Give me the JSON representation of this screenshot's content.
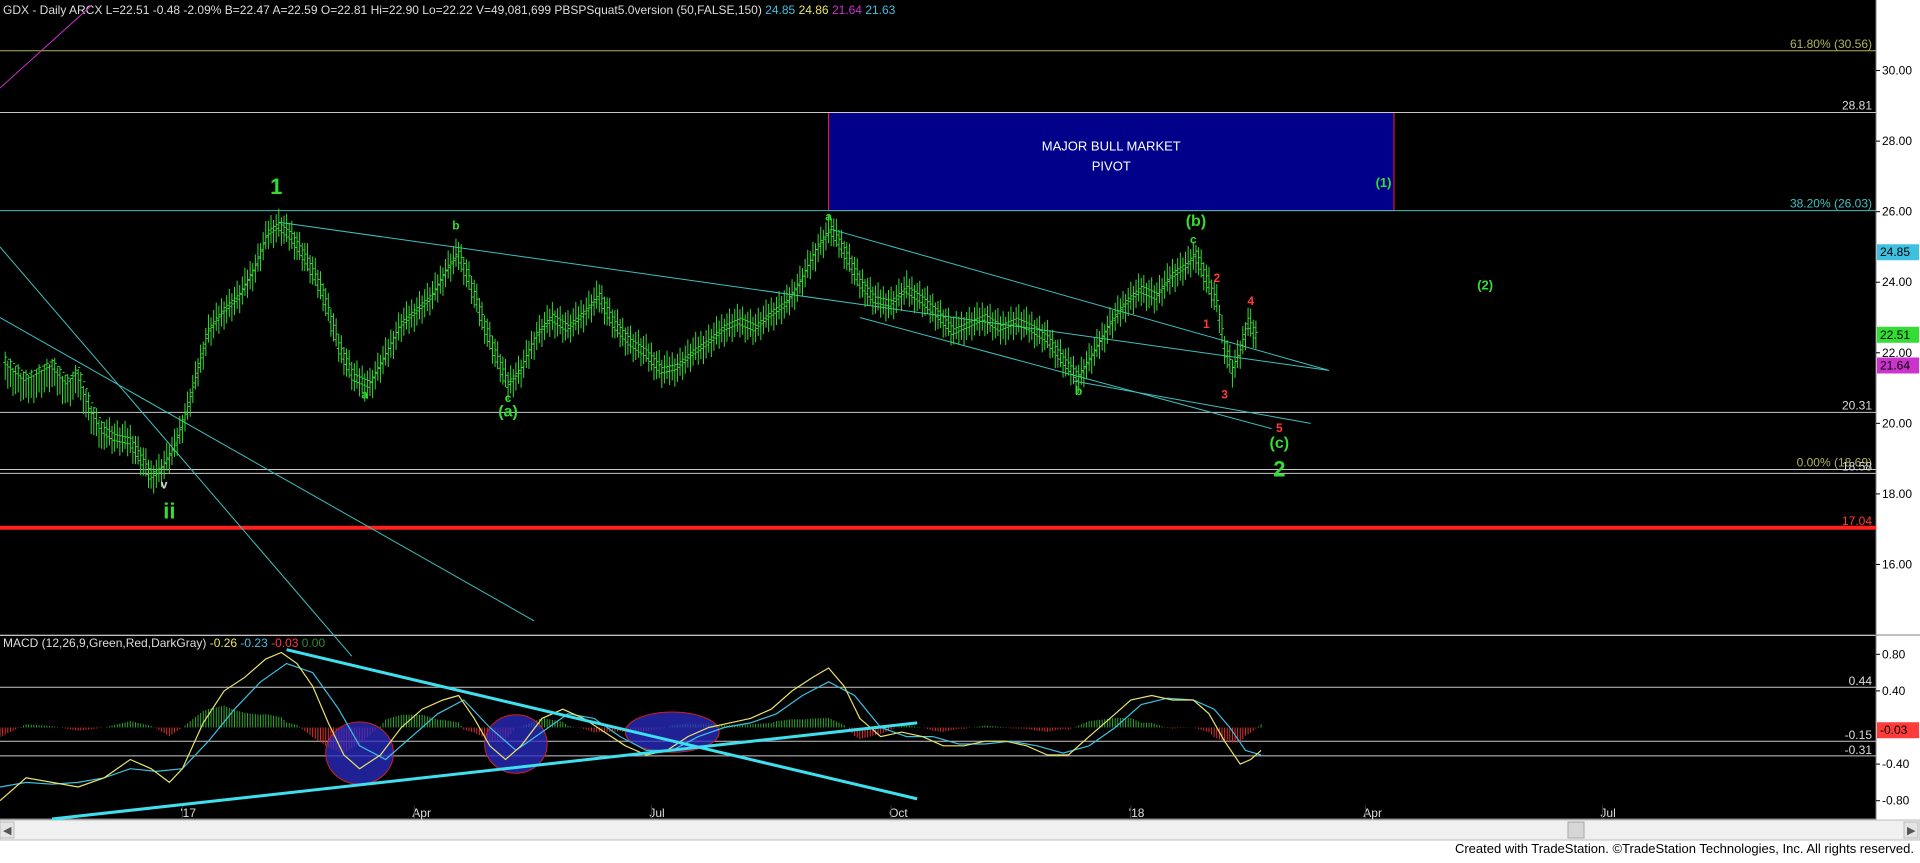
{
  "header": {
    "symbol_line": "GDX - Daily  ARCX  L=22.51  -0.48  -2.09%  B=22.47  A=22.59  O=22.81  Hi=22.90  Lo=22.22  V=49,081,699  PBSPSquat5.0version (50,FALSE,150)",
    "values": [
      {
        "text": "24.85",
        "color": "#3ec0e0"
      },
      {
        "text": "24.86",
        "color": "#e8e36a"
      },
      {
        "text": "21.64",
        "color": "#cc33cc"
      },
      {
        "text": "21.63",
        "color": "#3ec0e0"
      }
    ]
  },
  "macd": {
    "title": "MACD (12,26,9,Green,Red,DarkGray)",
    "values": [
      {
        "text": "-0.26",
        "color": "#e8e36a"
      },
      {
        "text": "-0.23",
        "color": "#3ec0e0"
      },
      {
        "text": "-0.03",
        "color": "#ff3b3b"
      },
      {
        "text": "0.00",
        "color": "#2e8b2e"
      }
    ],
    "ticks": [
      {
        "label": "0.80",
        "value": 0.8
      },
      {
        "label": "0.40",
        "value": 0.4
      },
      {
        "label": "-0.40",
        "value": -0.4
      },
      {
        "label": "-0.80",
        "value": -0.8
      }
    ],
    "level_labels": [
      {
        "label": "0.44",
        "value": 0.44
      },
      {
        "label": "-0.15",
        "value": -0.15
      },
      {
        "label": "-0.31",
        "value": -0.31
      }
    ],
    "current_badge": {
      "label": "-0.03",
      "value": -0.03,
      "color": "#ff3b3b"
    }
  },
  "pivot_box": {
    "line1": "MAJOR BULL MARKET",
    "line2": "PIVOT",
    "low": 26.03,
    "high": 28.81
  },
  "price_axis": {
    "ticks": [
      {
        "label": "30.00",
        "value": 30
      },
      {
        "label": "28.00",
        "value": 28
      },
      {
        "label": "26.00",
        "value": 26
      },
      {
        "label": "24.00",
        "value": 24
      },
      {
        "label": "22.00",
        "value": 22
      },
      {
        "label": "20.00",
        "value": 20
      },
      {
        "label": "18.00",
        "value": 18
      },
      {
        "label": "16.00",
        "value": 16
      }
    ],
    "badges": [
      {
        "label": "24.85",
        "value": 24.85,
        "color": "#3ec0e0"
      },
      {
        "label": "22.51",
        "value": 22.51,
        "color": "#33dd33"
      },
      {
        "label": "21.64",
        "value": 21.64,
        "color": "#cc33cc"
      }
    ]
  },
  "levels": [
    {
      "label": "61.80% (30.56)",
      "value": 30.56,
      "color": "#b3b35a",
      "label_color": "#b3b35a"
    },
    {
      "label": "28.81",
      "value": 28.81,
      "color": "#c8c8c8",
      "label_color": "#dddddd"
    },
    {
      "label": "38.20% (26.03)",
      "value": 26.03,
      "color": "#3ec0c0",
      "label_color": "#3ec0c0"
    },
    {
      "label": "20.31",
      "value": 20.31,
      "color": "#c8c8c8",
      "label_color": "#dddddd"
    },
    {
      "label": "0.00% (18.69)",
      "value": 18.69,
      "color": "#c8c8c8",
      "label_color": "#b3b35a"
    },
    {
      "label": "18.58",
      "value": 18.58,
      "color": "#c8c8c8",
      "label_color": "#dddddd"
    },
    {
      "label": "17.04",
      "value": 17.04,
      "color": "#ff2020",
      "label_color": "#ff3b3b"
    }
  ],
  "x_axis": {
    "ticks": [
      {
        "label": "'17",
        "day": 30
      },
      {
        "label": "Apr",
        "day": 119
      },
      {
        "label": "Jul",
        "day": 210
      },
      {
        "label": "Oct",
        "day": 302
      },
      {
        "label": "'18",
        "day": 394
      },
      {
        "label": "Apr",
        "day": 484
      },
      {
        "label": "Jul",
        "day": 575
      }
    ]
  },
  "wave_labels": [
    {
      "text": "1",
      "day": 66,
      "price": 26.5,
      "color": "#33dd33",
      "size": 22
    },
    {
      "text": "b",
      "day": 135,
      "price": 25.5,
      "color": "#33dd33",
      "size": 12
    },
    {
      "text": "a",
      "day": 100,
      "price": 20.7,
      "color": "#33dd33",
      "size": 12
    },
    {
      "text": "c",
      "day": 155,
      "price": 20.6,
      "color": "#33dd33",
      "size": 12
    },
    {
      "text": "(a)",
      "day": 155,
      "price": 20.2,
      "color": "#33dd33",
      "size": 16
    },
    {
      "text": "v",
      "day": 23,
      "price": 18.15,
      "color": "#dddddd",
      "size": 12
    },
    {
      "text": "ii",
      "day": 25,
      "price": 17.3,
      "color": "#33dd33",
      "size": 22
    },
    {
      "text": "a",
      "day": 278,
      "price": 25.75,
      "color": "#33dd33",
      "size": 12
    },
    {
      "text": "b",
      "day": 374,
      "price": 20.8,
      "color": "#33dd33",
      "size": 12
    },
    {
      "text": "(b)",
      "day": 419,
      "price": 25.6,
      "color": "#33dd33",
      "size": 16
    },
    {
      "text": "c",
      "day": 418,
      "price": 25.1,
      "color": "#33dd33",
      "size": 12
    },
    {
      "text": "2",
      "day": 427,
      "price": 24.0,
      "color": "#ff3b3b",
      "size": 12
    },
    {
      "text": "1",
      "day": 423,
      "price": 22.7,
      "color": "#ff3b3b",
      "size": 12
    },
    {
      "text": "3",
      "day": 430,
      "price": 20.7,
      "color": "#ff3b3b",
      "size": 12
    },
    {
      "text": "4",
      "day": 440,
      "price": 23.35,
      "color": "#ff3b3b",
      "size": 12
    },
    {
      "text": "5",
      "day": 451,
      "price": 19.75,
      "color": "#ff3b3b",
      "size": 12
    },
    {
      "text": "(c)",
      "day": 451,
      "price": 19.3,
      "color": "#33dd33",
      "size": 16
    },
    {
      "text": "2",
      "day": 451,
      "price": 18.5,
      "color": "#33dd33",
      "size": 22
    },
    {
      "text": "(1)",
      "day": 491,
      "price": 26.7,
      "color": "#33dd33",
      "size": 13
    },
    {
      "text": "(2)",
      "day": 530,
      "price": 23.8,
      "color": "#33dd33",
      "size": 13
    }
  ],
  "footer": "Created with TradeStation. ©TradeStation Technologies, Inc. All rights reserved.",
  "chart_data": {
    "type": "line",
    "title": "GDX - Daily",
    "xlabel": "",
    "ylabel": "",
    "x_range_days": [
      -40,
      680
    ],
    "ylim": [
      14.0,
      32.0
    ],
    "series": [
      {
        "points": [
          [
            -38,
            21.8
          ],
          [
            -30,
            21.3
          ],
          [
            -20,
            21.7
          ],
          [
            -14,
            21.2
          ],
          [
            -10,
            21.5
          ],
          [
            -5,
            20.5
          ],
          [
            0,
            19.8
          ],
          [
            4,
            19.6
          ],
          [
            10,
            19.5
          ],
          [
            15,
            18.9
          ],
          [
            18,
            18.5
          ],
          [
            22,
            18.7
          ],
          [
            27,
            19.3
          ],
          [
            32,
            20.4
          ],
          [
            36,
            21.5
          ],
          [
            40,
            22.6
          ],
          [
            46,
            23.2
          ],
          [
            52,
            23.6
          ],
          [
            58,
            24.4
          ],
          [
            63,
            25.4
          ],
          [
            67,
            25.6
          ],
          [
            72,
            25.3
          ],
          [
            78,
            24.6
          ],
          [
            84,
            23.7
          ],
          [
            90,
            22.2
          ],
          [
            96,
            21.3
          ],
          [
            102,
            21.1
          ],
          [
            108,
            21.9
          ],
          [
            114,
            22.8
          ],
          [
            120,
            23.2
          ],
          [
            126,
            23.6
          ],
          [
            132,
            24.4
          ],
          [
            136,
            24.8
          ],
          [
            140,
            24.1
          ],
          [
            145,
            23.0
          ],
          [
            150,
            22.0
          ],
          [
            155,
            21.1
          ],
          [
            160,
            21.5
          ],
          [
            166,
            22.5
          ],
          [
            172,
            23.0
          ],
          [
            178,
            22.7
          ],
          [
            184,
            23.1
          ],
          [
            190,
            23.6
          ],
          [
            196,
            22.8
          ],
          [
            202,
            22.3
          ],
          [
            208,
            22.0
          ],
          [
            214,
            21.5
          ],
          [
            220,
            21.6
          ],
          [
            226,
            22.0
          ],
          [
            232,
            22.3
          ],
          [
            238,
            22.7
          ],
          [
            244,
            22.9
          ],
          [
            250,
            22.7
          ],
          [
            256,
            23.1
          ],
          [
            262,
            23.4
          ],
          [
            268,
            24.1
          ],
          [
            274,
            25.0
          ],
          [
            279,
            25.5
          ],
          [
            284,
            24.9
          ],
          [
            290,
            24.0
          ],
          [
            296,
            23.5
          ],
          [
            302,
            23.4
          ],
          [
            308,
            23.8
          ],
          [
            314,
            23.5
          ],
          [
            320,
            23.1
          ],
          [
            326,
            22.6
          ],
          [
            332,
            22.8
          ],
          [
            338,
            23.0
          ],
          [
            344,
            22.7
          ],
          [
            350,
            22.9
          ],
          [
            356,
            22.7
          ],
          [
            362,
            22.4
          ],
          [
            368,
            21.8
          ],
          [
            374,
            21.3
          ],
          [
            380,
            22.0
          ],
          [
            386,
            22.8
          ],
          [
            392,
            23.4
          ],
          [
            398,
            23.8
          ],
          [
            404,
            23.6
          ],
          [
            410,
            24.2
          ],
          [
            416,
            24.5
          ],
          [
            419,
            24.8
          ],
          [
            423,
            24.1
          ],
          [
            427,
            23.4
          ],
          [
            430,
            22.2
          ],
          [
            433,
            21.5
          ],
          [
            436,
            22.0
          ],
          [
            439,
            22.9
          ],
          [
            442,
            22.5
          ]
        ]
      }
    ],
    "trendlines": [
      {
        "d1": 67,
        "p1": 25.7,
        "d2": 470,
        "p2": 21.5
      },
      {
        "d1": 279,
        "p1": 25.5,
        "d2": 470,
        "p2": 21.5
      },
      {
        "d1": 290,
        "p1": 23.0,
        "d2": 448,
        "p2": 19.85
      },
      {
        "d1": 372,
        "p1": 21.2,
        "d2": 463,
        "p2": 20.0
      },
      {
        "d1": -40,
        "p1": 25.0,
        "d2": 95,
        "p2": 13.4
      },
      {
        "d1": -40,
        "p1": 23.0,
        "d2": 165,
        "p2": 14.4
      }
    ],
    "macd_series": {
      "macd_line": [
        [
          -40,
          -0.8
        ],
        [
          -30,
          -0.55
        ],
        [
          -20,
          -0.6
        ],
        [
          -10,
          -0.65
        ],
        [
          0,
          -0.55
        ],
        [
          10,
          -0.35
        ],
        [
          18,
          -0.45
        ],
        [
          25,
          -0.6
        ],
        [
          30,
          -0.45
        ],
        [
          38,
          0.05
        ],
        [
          46,
          0.4
        ],
        [
          54,
          0.55
        ],
        [
          62,
          0.75
        ],
        [
          68,
          0.82
        ],
        [
          74,
          0.7
        ],
        [
          80,
          0.45
        ],
        [
          86,
          0.05
        ],
        [
          92,
          -0.3
        ],
        [
          98,
          -0.45
        ],
        [
          106,
          -0.3
        ],
        [
          114,
          0.0
        ],
        [
          122,
          0.2
        ],
        [
          130,
          0.3
        ],
        [
          136,
          0.35
        ],
        [
          142,
          0.1
        ],
        [
          148,
          -0.2
        ],
        [
          154,
          -0.35
        ],
        [
          160,
          -0.2
        ],
        [
          168,
          0.1
        ],
        [
          176,
          0.2
        ],
        [
          184,
          0.1
        ],
        [
          192,
          -0.05
        ],
        [
          200,
          -0.2
        ],
        [
          208,
          -0.3
        ],
        [
          216,
          -0.25
        ],
        [
          224,
          -0.1
        ],
        [
          232,
          0.0
        ],
        [
          240,
          0.05
        ],
        [
          248,
          0.1
        ],
        [
          256,
          0.2
        ],
        [
          264,
          0.4
        ],
        [
          272,
          0.55
        ],
        [
          278,
          0.65
        ],
        [
          284,
          0.45
        ],
        [
          290,
          0.1
        ],
        [
          298,
          -0.1
        ],
        [
          306,
          -0.05
        ],
        [
          314,
          -0.1
        ],
        [
          322,
          -0.2
        ],
        [
          330,
          -0.2
        ],
        [
          338,
          -0.15
        ],
        [
          346,
          -0.15
        ],
        [
          354,
          -0.2
        ],
        [
          362,
          -0.3
        ],
        [
          370,
          -0.3
        ],
        [
          378,
          -0.1
        ],
        [
          386,
          0.1
        ],
        [
          394,
          0.3
        ],
        [
          402,
          0.35
        ],
        [
          410,
          0.3
        ],
        [
          418,
          0.3
        ],
        [
          424,
          0.15
        ],
        [
          430,
          -0.15
        ],
        [
          436,
          -0.4
        ],
        [
          440,
          -0.35
        ],
        [
          444,
          -0.25
        ]
      ],
      "signal_line": [
        [
          -40,
          -0.65
        ],
        [
          -30,
          -0.6
        ],
        [
          -20,
          -0.62
        ],
        [
          -10,
          -0.6
        ],
        [
          0,
          -0.55
        ],
        [
          10,
          -0.45
        ],
        [
          20,
          -0.48
        ],
        [
          30,
          -0.45
        ],
        [
          40,
          -0.15
        ],
        [
          50,
          0.2
        ],
        [
          60,
          0.5
        ],
        [
          70,
          0.7
        ],
        [
          80,
          0.6
        ],
        [
          90,
          0.2
        ],
        [
          98,
          -0.2
        ],
        [
          108,
          -0.35
        ],
        [
          118,
          -0.1
        ],
        [
          128,
          0.15
        ],
        [
          138,
          0.3
        ],
        [
          148,
          0.0
        ],
        [
          158,
          -0.25
        ],
        [
          168,
          -0.05
        ],
        [
          178,
          0.15
        ],
        [
          188,
          0.1
        ],
        [
          198,
          -0.1
        ],
        [
          208,
          -0.25
        ],
        [
          218,
          -0.25
        ],
        [
          228,
          -0.1
        ],
        [
          238,
          0.0
        ],
        [
          248,
          0.05
        ],
        [
          258,
          0.15
        ],
        [
          268,
          0.35
        ],
        [
          278,
          0.5
        ],
        [
          288,
          0.35
        ],
        [
          298,
          0.0
        ],
        [
          308,
          -0.1
        ],
        [
          318,
          -0.1
        ],
        [
          328,
          -0.18
        ],
        [
          338,
          -0.18
        ],
        [
          348,
          -0.15
        ],
        [
          358,
          -0.2
        ],
        [
          368,
          -0.28
        ],
        [
          378,
          -0.2
        ],
        [
          388,
          0.0
        ],
        [
          398,
          0.25
        ],
        [
          408,
          0.32
        ],
        [
          418,
          0.3
        ],
        [
          426,
          0.2
        ],
        [
          432,
          0.0
        ],
        [
          438,
          -0.25
        ],
        [
          444,
          -0.3
        ]
      ],
      "trendlines": [
        {
          "d1": 70,
          "v1": 0.85,
          "d2": 312,
          "v2": -0.78
        },
        {
          "d1": -20,
          "v1": -1.0,
          "d2": 312,
          "v2": 0.05
        }
      ],
      "ellipses": [
        {
          "day": 98,
          "value": -0.28,
          "rdays": 13,
          "rval": 0.34
        },
        {
          "day": 158,
          "value": -0.18,
          "rdays": 12,
          "rval": 0.32
        },
        {
          "day": 218,
          "value": -0.05,
          "rdays": 18,
          "rval": 0.22
        }
      ]
    }
  }
}
